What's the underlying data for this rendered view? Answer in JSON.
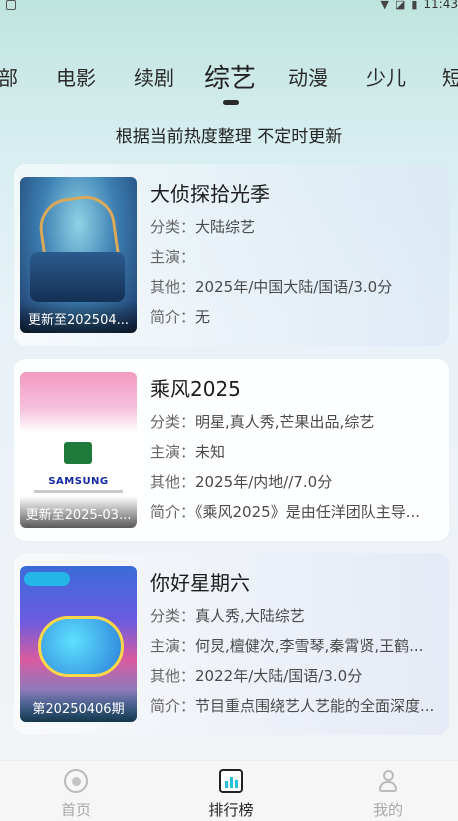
{
  "status_bar": {
    "time": "11:43"
  },
  "tabs": [
    "部",
    "电影",
    "续剧",
    "综艺",
    "动漫",
    "少儿",
    "短"
  ],
  "active_tab": "综艺",
  "subtitle": "根据当前热度整理 不定时更新",
  "labels": {
    "category": "分类：",
    "cast": "主演：",
    "other": "其他：",
    "intro": "简介："
  },
  "cards": [
    {
      "title": "大侦探拾光季",
      "poster_label": "更新至202504...",
      "category": "大陆综艺",
      "cast": "",
      "other": "2025年/中国大陆/国语/3.0分",
      "intro": "无"
    },
    {
      "title": "乘风2025",
      "poster_label": "更新至2025-03...",
      "poster_brand": "SAMSUNG",
      "category": "明星,真人秀,芒果出品,综艺",
      "cast": "未知",
      "other": "2025年/内地//7.0分",
      "intro": "《乘风2025》是由任洋团队主导..."
    },
    {
      "title": "你好星期六",
      "poster_label": "第20250406期",
      "category": "真人秀,大陆综艺",
      "cast": "何炅,檀健次,李雪琴,秦霄贤,王鹤...",
      "other": "2022年/大陆/国语/3.0分",
      "intro": "节目重点围绕艺人艺能的全面深度..."
    }
  ],
  "bottom_nav": [
    {
      "label": "首页",
      "icon": "home-icon"
    },
    {
      "label": "排行榜",
      "icon": "ranking-icon"
    },
    {
      "label": "我的",
      "icon": "profile-icon"
    }
  ],
  "active_nav": "排行榜"
}
